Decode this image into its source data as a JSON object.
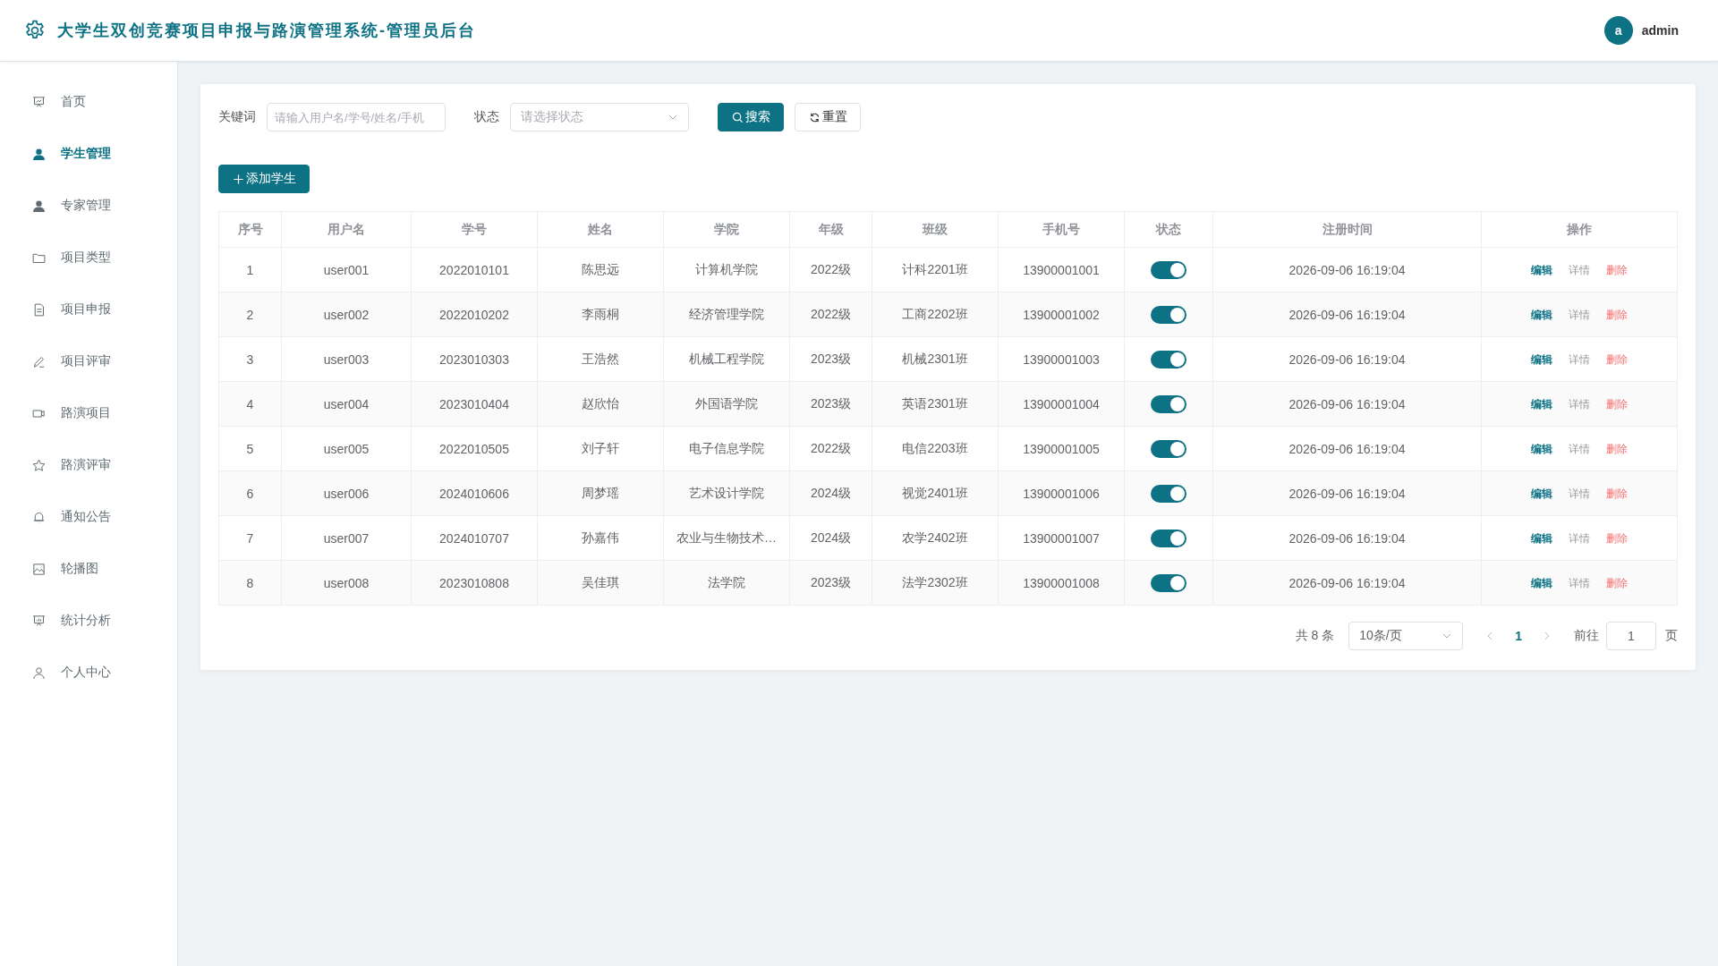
{
  "header": {
    "title": "大学生双创竞赛项目申报与路演管理系统-管理员后台",
    "avatar": "a",
    "user": "admin"
  },
  "sidebar": {
    "items": [
      {
        "label": "首页",
        "selected": false
      },
      {
        "label": "学生管理",
        "selected": true
      },
      {
        "label": "专家管理",
        "selected": false
      },
      {
        "label": "项目类型",
        "selected": false
      },
      {
        "label": "项目申报",
        "selected": false
      },
      {
        "label": "项目评审",
        "selected": false
      },
      {
        "label": "路演项目",
        "selected": false
      },
      {
        "label": "路演评审",
        "selected": false
      },
      {
        "label": "通知公告",
        "selected": false
      },
      {
        "label": "轮播图",
        "selected": false
      },
      {
        "label": "统计分析",
        "selected": false
      },
      {
        "label": "个人中心",
        "selected": false
      }
    ]
  },
  "filters": {
    "keyword_label": "关键词",
    "keyword": {
      "placeholder": "请输入用户名/学号/姓名/手机"
    },
    "status_label": "状态",
    "status": {
      "placeholder": "请选择状态"
    },
    "search_button": "搜索",
    "reset_button": "重置"
  },
  "add_button": "添加学生",
  "table": {
    "columns": [
      "序号",
      "用户名",
      "学号",
      "姓名",
      "学院",
      "年级",
      "班级",
      "手机号",
      "状态",
      "注册时间",
      "操作"
    ],
    "rows": [
      {
        "cells": [
          "1",
          "user001",
          "2022010101",
          "陈思远",
          "计算机学院",
          "2022级",
          "计科2201班",
          "13900001001"
        ],
        "on": true,
        "time": "2026-09-06 16:19:04",
        "actions": [
          "编辑",
          "详情",
          "删除"
        ]
      },
      {
        "cells": [
          "2",
          "user002",
          "2022010202",
          "李雨桐",
          "经济管理学院",
          "2022级",
          "工商2202班",
          "13900001002"
        ],
        "on": true,
        "time": "2026-09-06 16:19:04",
        "actions": [
          "编辑",
          "详情",
          "删除"
        ]
      },
      {
        "cells": [
          "3",
          "user003",
          "2023010303",
          "王浩然",
          "机械工程学院",
          "2023级",
          "机械2301班",
          "13900001003"
        ],
        "on": true,
        "time": "2026-09-06 16:19:04",
        "actions": [
          "编辑",
          "详情",
          "删除"
        ]
      },
      {
        "cells": [
          "4",
          "user004",
          "2023010404",
          "赵欣怡",
          "外国语学院",
          "2023级",
          "英语2301班",
          "13900001004"
        ],
        "on": true,
        "time": "2026-09-06 16:19:04",
        "actions": [
          "编辑",
          "详情",
          "删除"
        ]
      },
      {
        "cells": [
          "5",
          "user005",
          "2022010505",
          "刘子轩",
          "电子信息学院",
          "2022级",
          "电信2203班",
          "13900001005"
        ],
        "on": true,
        "time": "2026-09-06 16:19:04",
        "actions": [
          "编辑",
          "详情",
          "删除"
        ]
      },
      {
        "cells": [
          "6",
          "user006",
          "2024010606",
          "周梦瑶",
          "艺术设计学院",
          "2024级",
          "视觉2401班",
          "13900001006"
        ],
        "on": true,
        "time": "2026-09-06 16:19:04",
        "actions": [
          "编辑",
          "详情",
          "删除"
        ]
      },
      {
        "cells": [
          "7",
          "user007",
          "2024010707",
          "孙嘉伟",
          "农业与生物技术…",
          "2024级",
          "农学2402班",
          "13900001007"
        ],
        "on": true,
        "time": "2026-09-06 16:19:04",
        "actions": [
          "编辑",
          "详情",
          "删除"
        ]
      },
      {
        "cells": [
          "8",
          "user008",
          "2023010808",
          "吴佳琪",
          "法学院",
          "2023级",
          "法学2302班",
          "13900001008"
        ],
        "on": true,
        "time": "2026-09-06 16:19:04",
        "actions": [
          "编辑",
          "详情",
          "删除"
        ]
      }
    ]
  },
  "pagination": {
    "total": "共 8 条",
    "page_size": "10条/页",
    "pages": [
      {
        "label": "1",
        "selected": true
      }
    ],
    "goto_label": "前往",
    "goto_value": "1",
    "page_suffix": "页"
  }
}
